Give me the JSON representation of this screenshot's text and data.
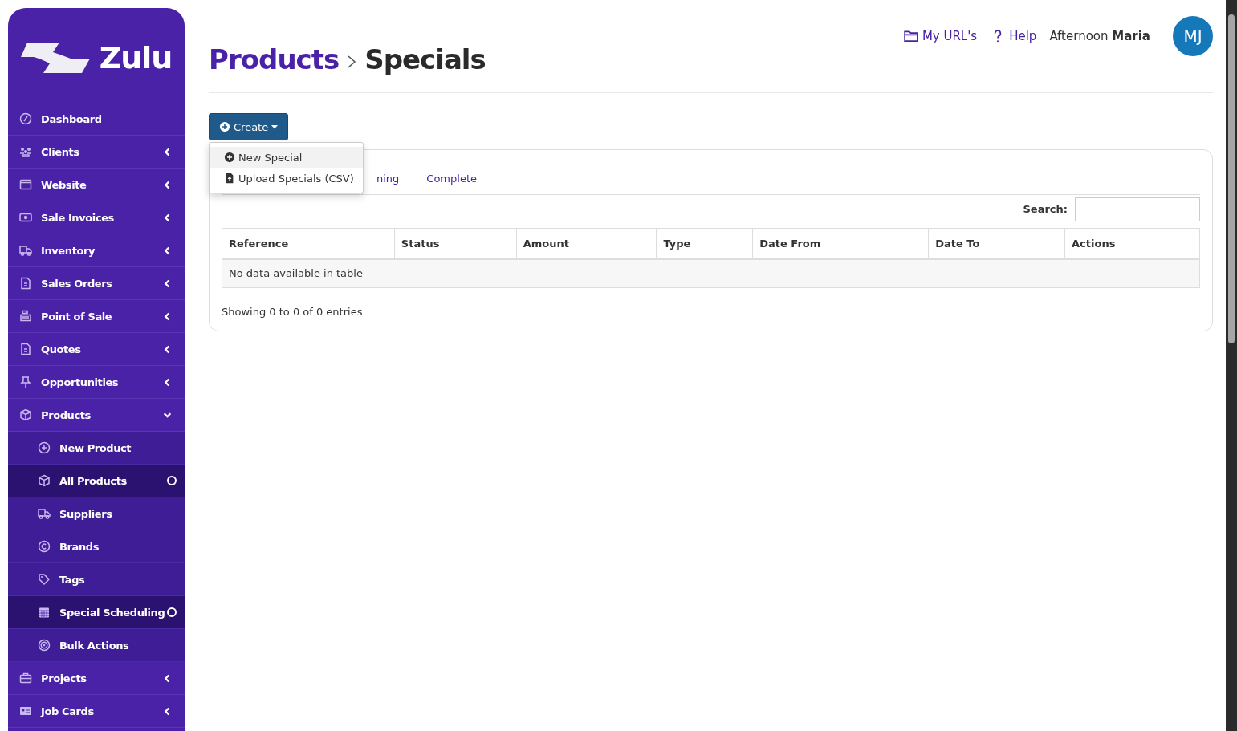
{
  "brand": {
    "name": "Zulu"
  },
  "sidebar": {
    "items": [
      {
        "label": "Dashboard",
        "has_arrow": false,
        "selected": false
      },
      {
        "label": "Clients",
        "has_arrow": true,
        "expanded": false,
        "selected": false
      },
      {
        "label": "Website",
        "has_arrow": true,
        "expanded": false,
        "selected": false
      },
      {
        "label": "Sale Invoices",
        "has_arrow": true,
        "expanded": false,
        "selected": false
      },
      {
        "label": "Inventory",
        "has_arrow": true,
        "expanded": false,
        "selected": false
      },
      {
        "label": "Sales Orders",
        "has_arrow": true,
        "expanded": false,
        "selected": false
      },
      {
        "label": "Point of Sale",
        "has_arrow": true,
        "expanded": false,
        "selected": false
      },
      {
        "label": "Quotes",
        "has_arrow": true,
        "expanded": false,
        "selected": false
      },
      {
        "label": "Opportunities",
        "has_arrow": true,
        "expanded": false,
        "selected": false
      },
      {
        "label": "Products",
        "has_arrow": true,
        "expanded": true,
        "selected": false,
        "children": [
          {
            "label": "New Product",
            "selected": false
          },
          {
            "label": "All Products",
            "selected": true
          },
          {
            "label": "Suppliers",
            "selected": false
          },
          {
            "label": "Brands",
            "selected": false
          },
          {
            "label": "Tags",
            "selected": false
          },
          {
            "label": "Special Scheduling",
            "selected": true
          },
          {
            "label": "Bulk Actions",
            "selected": false
          }
        ]
      },
      {
        "label": "Projects",
        "has_arrow": true,
        "expanded": false,
        "selected": false
      },
      {
        "label": "Job Cards",
        "has_arrow": true,
        "expanded": false,
        "selected": false
      }
    ]
  },
  "header": {
    "links": [
      "My URL's",
      "Help"
    ],
    "greeting": "Afternoon **Maria**",
    "avatar": "MJ"
  },
  "breadcrumb": [
    "Products",
    "Specials"
  ],
  "create_button": {
    "label": "Create",
    "menu": [
      {
        "label": "New Special",
        "selected": true
      },
      {
        "label": "Upload Specials (CSV)",
        "selected": false
      }
    ]
  },
  "tabs": [
    {
      "label": "ning",
      "selected": false
    },
    {
      "label": "Complete",
      "selected": false
    }
  ],
  "search": {
    "label": "Search:"
  },
  "table": {
    "columns": [
      "Reference",
      "Status",
      "Amount",
      "Type",
      "Date From",
      "Date To",
      "Actions"
    ],
    "empty_message": "No data available in table"
  },
  "info": "Showing 0 to 0 of 0 entries"
}
